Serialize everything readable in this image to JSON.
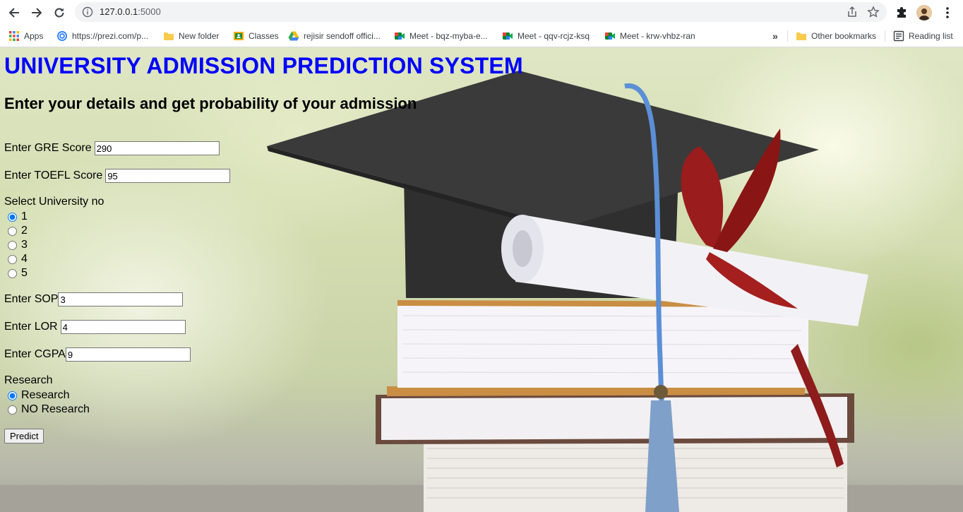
{
  "browser": {
    "url_host": "127.0.0.1",
    "url_port": ":5000",
    "bookmarks": [
      {
        "label": "Apps",
        "icon": "apps-grid-icon"
      },
      {
        "label": "https://prezi.com/p...",
        "icon": "prezi-icon"
      },
      {
        "label": "New folder",
        "icon": "folder-icon"
      },
      {
        "label": "Classes",
        "icon": "classroom-icon"
      },
      {
        "label": "rejisir sendoff offici...",
        "icon": "drive-icon"
      },
      {
        "label": "Meet - bqz-myba-e...",
        "icon": "meet-icon"
      },
      {
        "label": "Meet - qqv-rcjz-ksq",
        "icon": "meet-icon"
      },
      {
        "label": "Meet - krw-vhbz-ran",
        "icon": "meet-icon"
      }
    ],
    "overflow_label": "»",
    "other_bookmarks": "Other bookmarks",
    "reading_list": "Reading list"
  },
  "page": {
    "title": "UNIVERSITY ADMISSION PREDICTION SYSTEM",
    "subtitle": "Enter your details and get probability of your admission",
    "gre": {
      "label": "Enter GRE Score",
      "value": "290"
    },
    "toefl": {
      "label": "Enter TOEFL Score",
      "value": "95"
    },
    "university": {
      "label": "Select University no",
      "options": [
        "1",
        "2",
        "3",
        "4",
        "5"
      ],
      "selected": "1"
    },
    "sop": {
      "label": "Enter SOP",
      "value": "3"
    },
    "lor": {
      "label": "Enter LOR",
      "value": "4"
    },
    "cgpa": {
      "label": "Enter CGPA",
      "value": "9"
    },
    "research": {
      "label": "Research",
      "options": [
        "Research",
        "NO Research"
      ],
      "selected": "Research"
    },
    "predict_label": "Predict"
  },
  "colors": {
    "title": "#0000ff",
    "subtitle": "#000000",
    "radio_accent": "#1a73e8"
  }
}
